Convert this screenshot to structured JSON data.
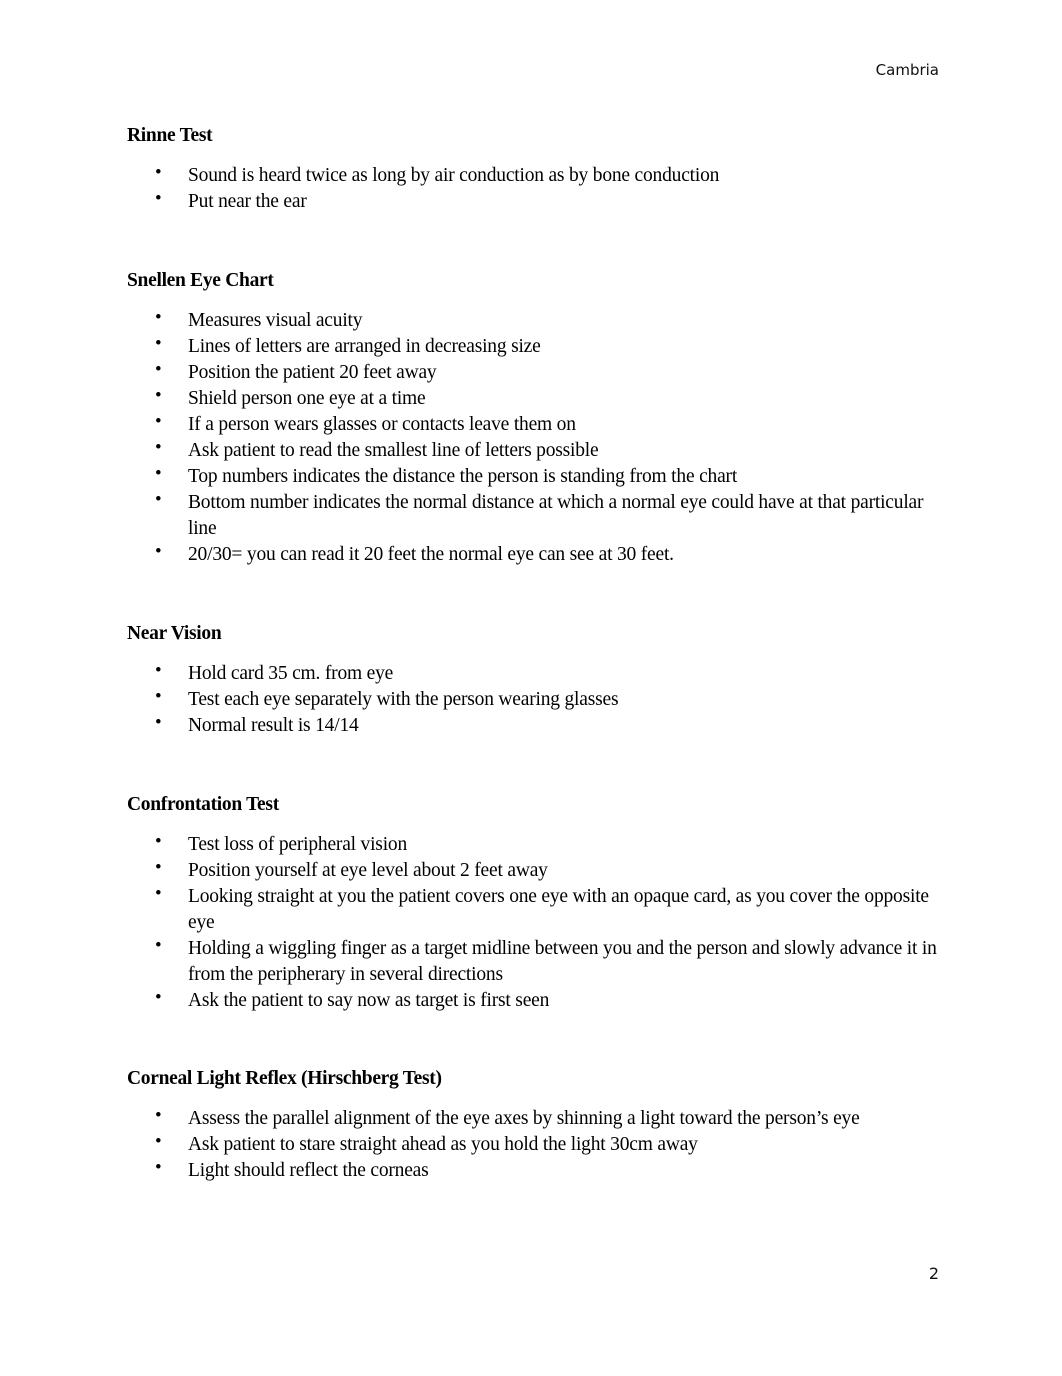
{
  "header": {
    "text": "Cambria"
  },
  "footer": {
    "page_number": "2"
  },
  "sections": [
    {
      "title": "Rinne Test",
      "items": [
        "Sound is heard twice as long by air conduction as by bone conduction",
        "Put near the ear"
      ]
    },
    {
      "title": "Snellen Eye Chart",
      "items": [
        "Measures visual acuity",
        "Lines of letters are arranged in decreasing size",
        "Position the patient 20 feet away",
        "Shield person one eye at a time",
        "If a person wears glasses or contacts leave them on",
        "Ask patient to read the smallest line of letters possible",
        "Top numbers indicates the distance the person is standing from the chart",
        "Bottom number indicates the normal distance at which a normal eye could have at that particular line",
        "20/30= you can read it 20 feet the normal eye can see at 30 feet."
      ]
    },
    {
      "title": "Near Vision",
      "items": [
        "Hold card 35 cm. from eye",
        "Test each eye separately with the person wearing glasses",
        "Normal result is 14/14"
      ]
    },
    {
      "title": "Confrontation Test",
      "items": [
        "Test loss of peripheral vision",
        "Position yourself at eye level about 2 feet away",
        "Looking straight at you the patient covers one eye with an opaque card, as you cover the opposite eye",
        "Holding a wiggling finger as a target midline between you and the person and slowly advance it in from the peripherary in several directions",
        "Ask the patient to say now as target is first seen"
      ]
    },
    {
      "title": "Corneal Light Reflex (Hirschberg Test)",
      "items": [
        "Assess the parallel alignment of the eye axes by shinning a light toward the person’s eye",
        "Ask patient to stare straight ahead as you hold the light 30cm away",
        "Light should reflect the corneas"
      ]
    }
  ]
}
